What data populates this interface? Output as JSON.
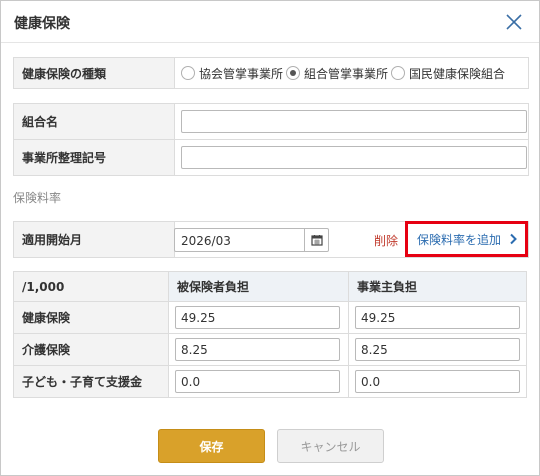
{
  "dialog": {
    "title": "健康保険"
  },
  "insurance_type": {
    "label": "健康保険の種類",
    "options": [
      {
        "label": "協会管掌事業所",
        "selected": false
      },
      {
        "label": "組合管掌事業所",
        "selected": true
      },
      {
        "label": "国民健康保険組合",
        "selected": false
      }
    ]
  },
  "union_name": {
    "label": "組合名",
    "value": ""
  },
  "office_code": {
    "label": "事業所整理記号",
    "value": ""
  },
  "rates_section": {
    "title": "保険料率",
    "start_month": {
      "label": "適用開始月",
      "value": "2026/03"
    },
    "delete_label": "削除",
    "add_label": "保険料率を追加"
  },
  "rate_table": {
    "unit_header": "/1,000",
    "insured_header": "被保険者負担",
    "employer_header": "事業主負担",
    "rows": [
      {
        "label": "健康保険",
        "insured": "49.25",
        "employer": "49.25"
      },
      {
        "label": "介護保険",
        "insured": "8.25",
        "employer": "8.25"
      },
      {
        "label": "子ども・子育て支援金",
        "insured": "0.0",
        "employer": "0.0"
      }
    ]
  },
  "buttons": {
    "save": "保存",
    "cancel": "キャンセル"
  },
  "colors": {
    "save": "#d9a12a",
    "highlight": "#e60012",
    "delete": "#c0392b",
    "link": "#2b6cb0"
  },
  "icons": {
    "close": "close-icon",
    "calendar": "calendar-icon",
    "chevron": "chevron-right-icon"
  }
}
